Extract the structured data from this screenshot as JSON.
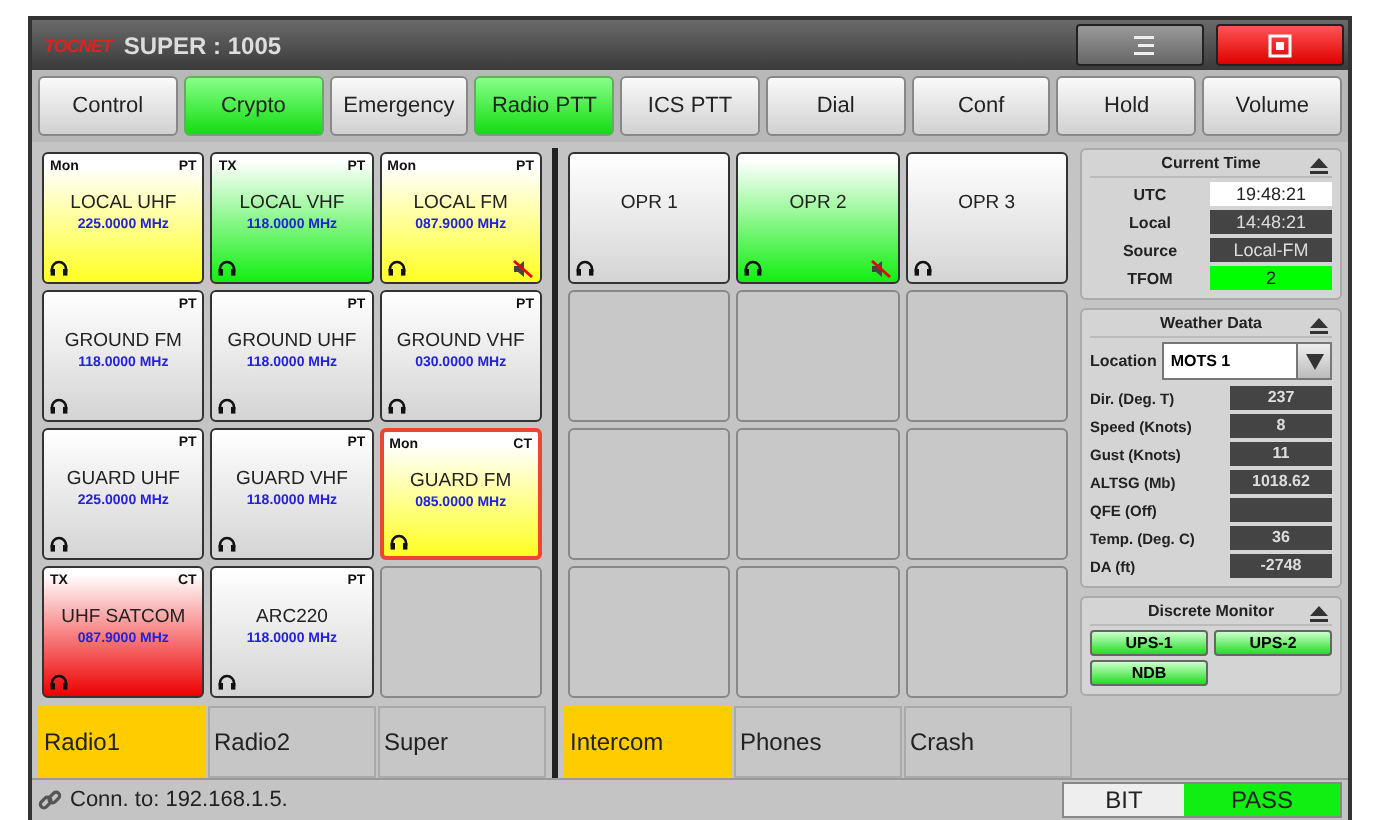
{
  "window": {
    "title": "SUPER : 1005",
    "logo": "TOCNET"
  },
  "tabs": [
    {
      "label": "Control",
      "on": false
    },
    {
      "label": "Crypto",
      "on": true
    },
    {
      "label": "Emergency",
      "on": false
    },
    {
      "label": "Radio PTT",
      "on": true
    },
    {
      "label": "ICS PTT",
      "on": false
    },
    {
      "label": "Dial",
      "on": false
    },
    {
      "label": "Conf",
      "on": false
    },
    {
      "label": "Hold",
      "on": false
    },
    {
      "label": "Volume",
      "on": false
    }
  ],
  "radios": {
    "tiles": [
      {
        "kind": "monitor",
        "mode": "Mon",
        "type": "PT",
        "name": "LOCAL UHF",
        "freq": "225.0000 MHz",
        "muted": false,
        "alert": false
      },
      {
        "kind": "transmit",
        "mode": "TX",
        "type": "PT",
        "name": "LOCAL VHF",
        "freq": "118.0000 MHz",
        "muted": false,
        "alert": false
      },
      {
        "kind": "monitor",
        "mode": "Mon",
        "type": "PT",
        "name": "LOCAL FM",
        "freq": "087.9000 MHz",
        "muted": true,
        "alert": false
      },
      {
        "kind": "idle",
        "type": "PT",
        "name": "GROUND FM",
        "freq": "118.0000 MHz",
        "muted": false,
        "alert": false
      },
      {
        "kind": "idle",
        "type": "PT",
        "name": "GROUND UHF",
        "freq": "118.0000 MHz",
        "muted": false,
        "alert": false
      },
      {
        "kind": "idle",
        "type": "PT",
        "name": "GROUND VHF",
        "freq": "030.0000 MHz",
        "muted": false,
        "alert": false
      },
      {
        "kind": "idle",
        "type": "PT",
        "name": "GUARD UHF",
        "freq": "225.0000 MHz",
        "muted": false,
        "alert": false
      },
      {
        "kind": "idle",
        "type": "PT",
        "name": "GUARD VHF",
        "freq": "118.0000 MHz",
        "muted": false,
        "alert": false
      },
      {
        "kind": "monitor",
        "mode": "Mon",
        "type": "CT",
        "name": "GUARD FM",
        "freq": "085.0000 MHz",
        "muted": false,
        "alert": true
      },
      {
        "kind": "emergency",
        "mode": "TX",
        "type": "CT",
        "name": "UHF SATCOM",
        "freq": "087.9000 MHz",
        "muted": false,
        "alert": false
      },
      {
        "kind": "idle",
        "type": "PT",
        "name": "ARC220",
        "freq": "118.0000 MHz",
        "muted": false,
        "alert": false
      },
      {
        "kind": "empty"
      }
    ],
    "pages": [
      {
        "label": "Radio1",
        "selected": true
      },
      {
        "label": "Radio2",
        "selected": false
      },
      {
        "label": "Super",
        "selected": false
      }
    ]
  },
  "intercom": {
    "tiles": [
      {
        "kind": "idle",
        "name": "OPR 1",
        "muted": false
      },
      {
        "kind": "transmit",
        "name": "OPR 2",
        "muted": true
      },
      {
        "kind": "idle",
        "name": "OPR 3",
        "muted": false
      },
      {
        "kind": "empty"
      },
      {
        "kind": "empty"
      },
      {
        "kind": "empty"
      },
      {
        "kind": "empty"
      },
      {
        "kind": "empty"
      },
      {
        "kind": "empty"
      },
      {
        "kind": "empty"
      },
      {
        "kind": "empty"
      },
      {
        "kind": "empty"
      }
    ],
    "pages": [
      {
        "label": "Intercom",
        "selected": true
      },
      {
        "label": "Phones",
        "selected": false
      },
      {
        "label": "Crash",
        "selected": false
      }
    ]
  },
  "current_time": {
    "title": "Current Time",
    "rows": [
      {
        "label": "UTC",
        "value": "19:48:21",
        "kind": "light"
      },
      {
        "label": "Local",
        "value": "14:48:21",
        "kind": "dark"
      },
      {
        "label": "Source",
        "value": "Local-FM",
        "kind": "dark"
      },
      {
        "label": "TFOM",
        "value": "2",
        "kind": "ok"
      }
    ]
  },
  "weather": {
    "title": "Weather Data",
    "location_label": "Location",
    "location": "MOTS 1",
    "rows": [
      {
        "label": "Dir. (Deg. T)",
        "value": "237"
      },
      {
        "label": "Speed (Knots)",
        "value": "8"
      },
      {
        "label": "Gust (Knots)",
        "value": "11"
      },
      {
        "label": "ALTSG (Mb)",
        "value": "1018.62"
      },
      {
        "label": "QFE (Off)"
      },
      {
        "label": "Temp. (Deg. C)",
        "value": "36"
      },
      {
        "label": "DA (ft)",
        "value": "-2748"
      }
    ]
  },
  "discrete_monitor": {
    "title": "Discrete Monitor",
    "items": [
      {
        "label": "UPS-1",
        "on": true
      },
      {
        "label": "UPS-2",
        "on": true
      },
      {
        "label": "NDB",
        "on": true
      }
    ]
  },
  "status_bar": {
    "connection": "Conn. to: 192.168.1.5.",
    "bit_label": "BIT",
    "bit_result": "PASS",
    "bit_ok": true
  }
}
